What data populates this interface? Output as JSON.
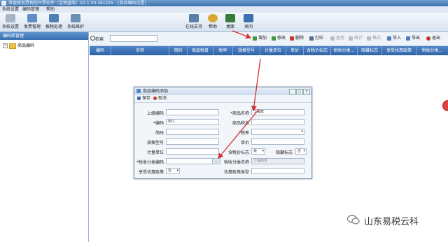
{
  "window": {
    "title": "增值税发票税控开票软件（金税盘版）V2.1.30.161225 - [商品编码设置]"
  },
  "menu": [
    "系统设置",
    "编码管理",
    "帮助"
  ],
  "toolbar": {
    "left": [
      {
        "label": "系统设置",
        "icon": "settings-icon",
        "color": "#a7b6c6"
      },
      {
        "label": "发票管理",
        "icon": "invoice-icon",
        "color": "#5e8ec5"
      },
      {
        "label": "报税处理",
        "icon": "tax-report-icon",
        "color": "#4f7fb8"
      },
      {
        "label": "系统维护",
        "icon": "maintenance-icon",
        "color": "#6b8fb5"
      }
    ],
    "right": [
      {
        "label": "在线支持",
        "icon": "support-icon",
        "color": "#5b7fa8"
      },
      {
        "label": "帮助",
        "icon": "help-icon",
        "color": "#d9a638"
      },
      {
        "label": "桌面",
        "icon": "desktop-icon",
        "color": "#3a7a3a"
      },
      {
        "label": "关闭",
        "icon": "close-icon",
        "color": "#3c6fb0"
      }
    ]
  },
  "left_panel": {
    "header": "编码库管理",
    "tree_item": "商品编码"
  },
  "search": {
    "label": "检索",
    "value": ""
  },
  "actions": [
    {
      "label": "增加",
      "color": "#3d9a3d",
      "enabled": true
    },
    {
      "label": "修改",
      "color": "#3d9a3d",
      "enabled": true
    },
    {
      "label": "删除",
      "color": "#c0392b",
      "enabled": true
    },
    {
      "label": "打印",
      "color": "#5a6f86",
      "enabled": true
    },
    {
      "label": "查找",
      "color": "#aaaaaa",
      "enabled": false
    },
    {
      "label": "统计",
      "color": "#aaaaaa",
      "enabled": false
    },
    {
      "label": "格式",
      "color": "#aaaaaa",
      "enabled": false
    },
    {
      "label": "导入",
      "color": "#4f7fb8",
      "enabled": true
    },
    {
      "label": "导出",
      "color": "#4f7fb8",
      "enabled": true
    },
    {
      "label": "退出",
      "color": "#c0392b",
      "enabled": true
    }
  ],
  "grid": {
    "columns": [
      "编码",
      "名称",
      "简码",
      "商品税目",
      "税率",
      "规格型号",
      "计量单位",
      "单价",
      "含税价标志",
      "税收分类...",
      "隐藏标志",
      "享受优惠政策",
      "税收分类..."
    ]
  },
  "dialog": {
    "title": "商品编码添加",
    "tools": [
      {
        "label": "保存",
        "color": "#3d6fb0"
      },
      {
        "label": "取消",
        "color": "#c0392b"
      }
    ],
    "fields_left": [
      {
        "label": "上级编码",
        "value": ""
      },
      {
        "label": "*编码",
        "value": "001"
      },
      {
        "label": "简码",
        "value": ""
      },
      {
        "label": "规格型号",
        "value": ""
      },
      {
        "label": "计量单位",
        "value": ""
      },
      {
        "label": "*税收分类编码",
        "value": ""
      },
      {
        "label": "享受优惠政策",
        "value": "否"
      }
    ],
    "fields_right": [
      {
        "label": "*商品名称",
        "value": "工程款"
      },
      {
        "label": "商品税目",
        "value": ""
      },
      {
        "label": "*税率",
        "value": ""
      },
      {
        "label": "单价",
        "value": ""
      },
      {
        "label": "含税价标志",
        "value": "是"
      },
      {
        "label": "隐藏标志",
        "value": "否"
      },
      {
        "label": "税收分类名称",
        "value": "工程服务"
      },
      {
        "label": "优惠政策类型",
        "value": ""
      }
    ],
    "window_buttons": [
      "-",
      "□",
      "×"
    ]
  },
  "watermark": {
    "text": "山东易税云科"
  },
  "colors": {
    "accent": "#3f72ad",
    "annotation": "#d32f2f"
  }
}
